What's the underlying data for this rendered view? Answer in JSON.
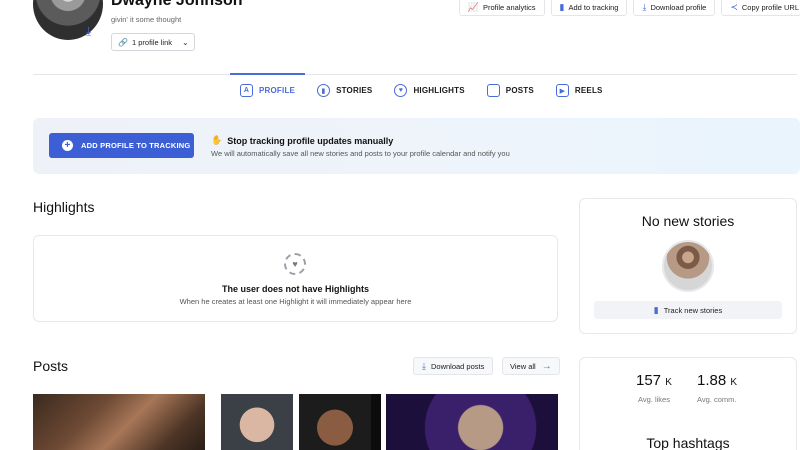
{
  "profile": {
    "name": "Dwayne Johnson",
    "bio": "givin' it some thought",
    "link_button": "1 profile link"
  },
  "top_actions": [
    {
      "label": "Profile analytics",
      "icon": "chart-line-icon"
    },
    {
      "label": "Add to tracking",
      "icon": "bar-chart-icon"
    },
    {
      "label": "Download profile",
      "icon": "download-icon"
    },
    {
      "label": "Copy profile URL",
      "icon": "share-icon"
    }
  ],
  "tabs": [
    {
      "label": "PROFILE",
      "active": true
    },
    {
      "label": "STORIES",
      "active": false
    },
    {
      "label": "HIGHLIGHTS",
      "active": false
    },
    {
      "label": "POSTS",
      "active": false
    },
    {
      "label": "REELS",
      "active": false
    }
  ],
  "banner": {
    "button": "ADD PROFILE TO TRACKING",
    "title": "Stop tracking profile updates manually",
    "subtitle": "We will automatically save all new stories and posts to your profile calendar and notify you"
  },
  "highlights": {
    "title": "Highlights",
    "empty_title": "The user does not have Highlights",
    "empty_subtitle": "When he creates at least one Highlight it will immediately appear here"
  },
  "stories": {
    "title": "No new stories",
    "track_button": "Track new stories"
  },
  "posts": {
    "title": "Posts",
    "download_button": "Download posts",
    "view_all": "View all"
  },
  "stats": {
    "likes_value": "157",
    "likes_unit": "K",
    "likes_label": "Avg. likes",
    "comments_value": "1.88",
    "comments_unit": "K",
    "comments_label": "Avg. comm.",
    "hashtags_title": "Top hashtags"
  },
  "colors": {
    "accent": "#4a6bd8",
    "primary_button": "#3d5fd6"
  }
}
